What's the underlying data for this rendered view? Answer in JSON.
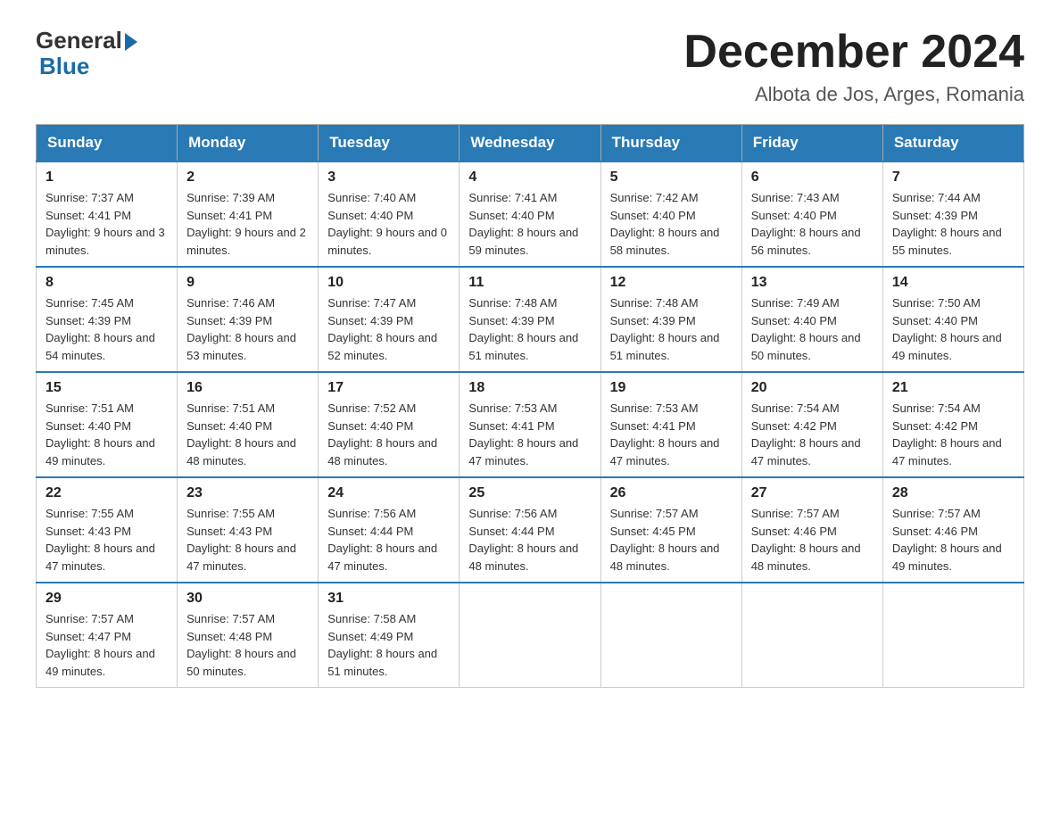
{
  "logo": {
    "general": "General",
    "blue": "Blue"
  },
  "title": "December 2024",
  "location": "Albota de Jos, Arges, Romania",
  "days_of_week": [
    "Sunday",
    "Monday",
    "Tuesday",
    "Wednesday",
    "Thursday",
    "Friday",
    "Saturday"
  ],
  "weeks": [
    [
      {
        "day": "1",
        "sunrise": "7:37 AM",
        "sunset": "4:41 PM",
        "daylight": "9 hours and 3 minutes."
      },
      {
        "day": "2",
        "sunrise": "7:39 AM",
        "sunset": "4:41 PM",
        "daylight": "9 hours and 2 minutes."
      },
      {
        "day": "3",
        "sunrise": "7:40 AM",
        "sunset": "4:40 PM",
        "daylight": "9 hours and 0 minutes."
      },
      {
        "day": "4",
        "sunrise": "7:41 AM",
        "sunset": "4:40 PM",
        "daylight": "8 hours and 59 minutes."
      },
      {
        "day": "5",
        "sunrise": "7:42 AM",
        "sunset": "4:40 PM",
        "daylight": "8 hours and 58 minutes."
      },
      {
        "day": "6",
        "sunrise": "7:43 AM",
        "sunset": "4:40 PM",
        "daylight": "8 hours and 56 minutes."
      },
      {
        "day": "7",
        "sunrise": "7:44 AM",
        "sunset": "4:39 PM",
        "daylight": "8 hours and 55 minutes."
      }
    ],
    [
      {
        "day": "8",
        "sunrise": "7:45 AM",
        "sunset": "4:39 PM",
        "daylight": "8 hours and 54 minutes."
      },
      {
        "day": "9",
        "sunrise": "7:46 AM",
        "sunset": "4:39 PM",
        "daylight": "8 hours and 53 minutes."
      },
      {
        "day": "10",
        "sunrise": "7:47 AM",
        "sunset": "4:39 PM",
        "daylight": "8 hours and 52 minutes."
      },
      {
        "day": "11",
        "sunrise": "7:48 AM",
        "sunset": "4:39 PM",
        "daylight": "8 hours and 51 minutes."
      },
      {
        "day": "12",
        "sunrise": "7:48 AM",
        "sunset": "4:39 PM",
        "daylight": "8 hours and 51 minutes."
      },
      {
        "day": "13",
        "sunrise": "7:49 AM",
        "sunset": "4:40 PM",
        "daylight": "8 hours and 50 minutes."
      },
      {
        "day": "14",
        "sunrise": "7:50 AM",
        "sunset": "4:40 PM",
        "daylight": "8 hours and 49 minutes."
      }
    ],
    [
      {
        "day": "15",
        "sunrise": "7:51 AM",
        "sunset": "4:40 PM",
        "daylight": "8 hours and 49 minutes."
      },
      {
        "day": "16",
        "sunrise": "7:51 AM",
        "sunset": "4:40 PM",
        "daylight": "8 hours and 48 minutes."
      },
      {
        "day": "17",
        "sunrise": "7:52 AM",
        "sunset": "4:40 PM",
        "daylight": "8 hours and 48 minutes."
      },
      {
        "day": "18",
        "sunrise": "7:53 AM",
        "sunset": "4:41 PM",
        "daylight": "8 hours and 47 minutes."
      },
      {
        "day": "19",
        "sunrise": "7:53 AM",
        "sunset": "4:41 PM",
        "daylight": "8 hours and 47 minutes."
      },
      {
        "day": "20",
        "sunrise": "7:54 AM",
        "sunset": "4:42 PM",
        "daylight": "8 hours and 47 minutes."
      },
      {
        "day": "21",
        "sunrise": "7:54 AM",
        "sunset": "4:42 PM",
        "daylight": "8 hours and 47 minutes."
      }
    ],
    [
      {
        "day": "22",
        "sunrise": "7:55 AM",
        "sunset": "4:43 PM",
        "daylight": "8 hours and 47 minutes."
      },
      {
        "day": "23",
        "sunrise": "7:55 AM",
        "sunset": "4:43 PM",
        "daylight": "8 hours and 47 minutes."
      },
      {
        "day": "24",
        "sunrise": "7:56 AM",
        "sunset": "4:44 PM",
        "daylight": "8 hours and 47 minutes."
      },
      {
        "day": "25",
        "sunrise": "7:56 AM",
        "sunset": "4:44 PM",
        "daylight": "8 hours and 48 minutes."
      },
      {
        "day": "26",
        "sunrise": "7:57 AM",
        "sunset": "4:45 PM",
        "daylight": "8 hours and 48 minutes."
      },
      {
        "day": "27",
        "sunrise": "7:57 AM",
        "sunset": "4:46 PM",
        "daylight": "8 hours and 48 minutes."
      },
      {
        "day": "28",
        "sunrise": "7:57 AM",
        "sunset": "4:46 PM",
        "daylight": "8 hours and 49 minutes."
      }
    ],
    [
      {
        "day": "29",
        "sunrise": "7:57 AM",
        "sunset": "4:47 PM",
        "daylight": "8 hours and 49 minutes."
      },
      {
        "day": "30",
        "sunrise": "7:57 AM",
        "sunset": "4:48 PM",
        "daylight": "8 hours and 50 minutes."
      },
      {
        "day": "31",
        "sunrise": "7:58 AM",
        "sunset": "4:49 PM",
        "daylight": "8 hours and 51 minutes."
      },
      null,
      null,
      null,
      null
    ]
  ]
}
